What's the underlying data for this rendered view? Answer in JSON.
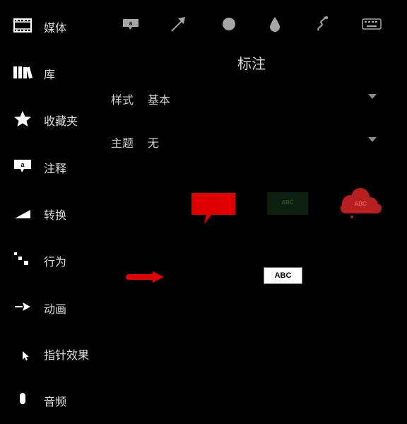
{
  "sidebar": {
    "items": [
      {
        "label": "媒体",
        "icon": "film-strip-icon"
      },
      {
        "label": "库",
        "icon": "library-books-icon"
      },
      {
        "label": "收藏夹",
        "icon": "star-icon"
      },
      {
        "label": "注释",
        "icon": "callout-icon"
      },
      {
        "label": "转换",
        "icon": "transition-icon"
      },
      {
        "label": "行为",
        "icon": "behavior-dots-icon"
      },
      {
        "label": "动画",
        "icon": "animation-arrow-icon"
      },
      {
        "label": "指针效果",
        "icon": "cursor-icon"
      },
      {
        "label": "音频",
        "icon": "audio-icon"
      }
    ]
  },
  "toolbar": {
    "tools": [
      "callout-tool-icon",
      "arrow-tool-icon",
      "shape-tool-icon",
      "blur-tool-icon",
      "sketch-tool-icon",
      "keyboard-tool-icon"
    ]
  },
  "panel": {
    "title": "标注",
    "style_dropdown": {
      "label": "样式",
      "value": "基本"
    },
    "theme_dropdown": {
      "label": "主题",
      "value": "无"
    }
  },
  "gallery": {
    "abc_text": "ABC",
    "colors": {
      "red": "#e00000",
      "dark_green": "#0f1f0f",
      "green_text": "#1e5a1e",
      "cloud_red": "#b81f1f"
    }
  }
}
